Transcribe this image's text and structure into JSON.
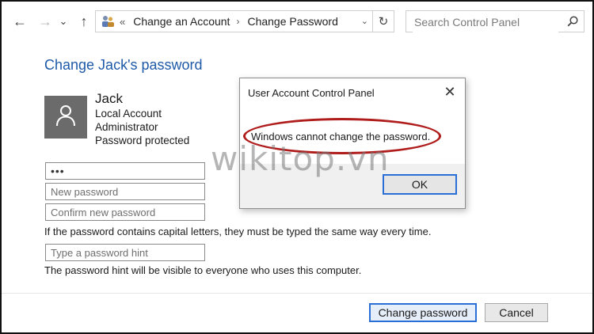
{
  "navigation": {
    "back_glyph": "←",
    "forward_glyph": "→",
    "recent_glyph": "⌄",
    "up_glyph": "↑"
  },
  "address_bar": {
    "overflow_glyph": "«",
    "crumbs": [
      "Change an Account",
      "Change Password"
    ],
    "separator": "›",
    "dropdown_glyph": "⌄",
    "refresh_glyph": "↻"
  },
  "search": {
    "placeholder": "Search Control Panel",
    "icon": "search-icon"
  },
  "page": {
    "heading": "Change Jack's password",
    "user": {
      "name": "Jack",
      "account_type": "Local Account",
      "role": "Administrator",
      "protection": "Password protected"
    },
    "fields": {
      "current_password_value": "•••",
      "new_password_placeholder": "New password",
      "confirm_password_placeholder": "Confirm new password",
      "hint_placeholder": "Type a password hint"
    },
    "case_note": "If the password contains capital letters, they must be typed the same way every time.",
    "hint_note": "The password hint will be visible to everyone who uses this computer.",
    "buttons": {
      "change_password": "Change password",
      "cancel": "Cancel"
    }
  },
  "dialog": {
    "title": "User Account Control Panel",
    "message": "Windows cannot change the password.",
    "ok_label": "OK",
    "close_glyph": "✕"
  },
  "watermark": "wikitop.vn",
  "colors": {
    "heading_blue": "#1e5aa8",
    "highlight_red": "#b01c1c",
    "button_focus_blue": "#2a6fd6",
    "avatar_gray": "#6b6b6b"
  }
}
